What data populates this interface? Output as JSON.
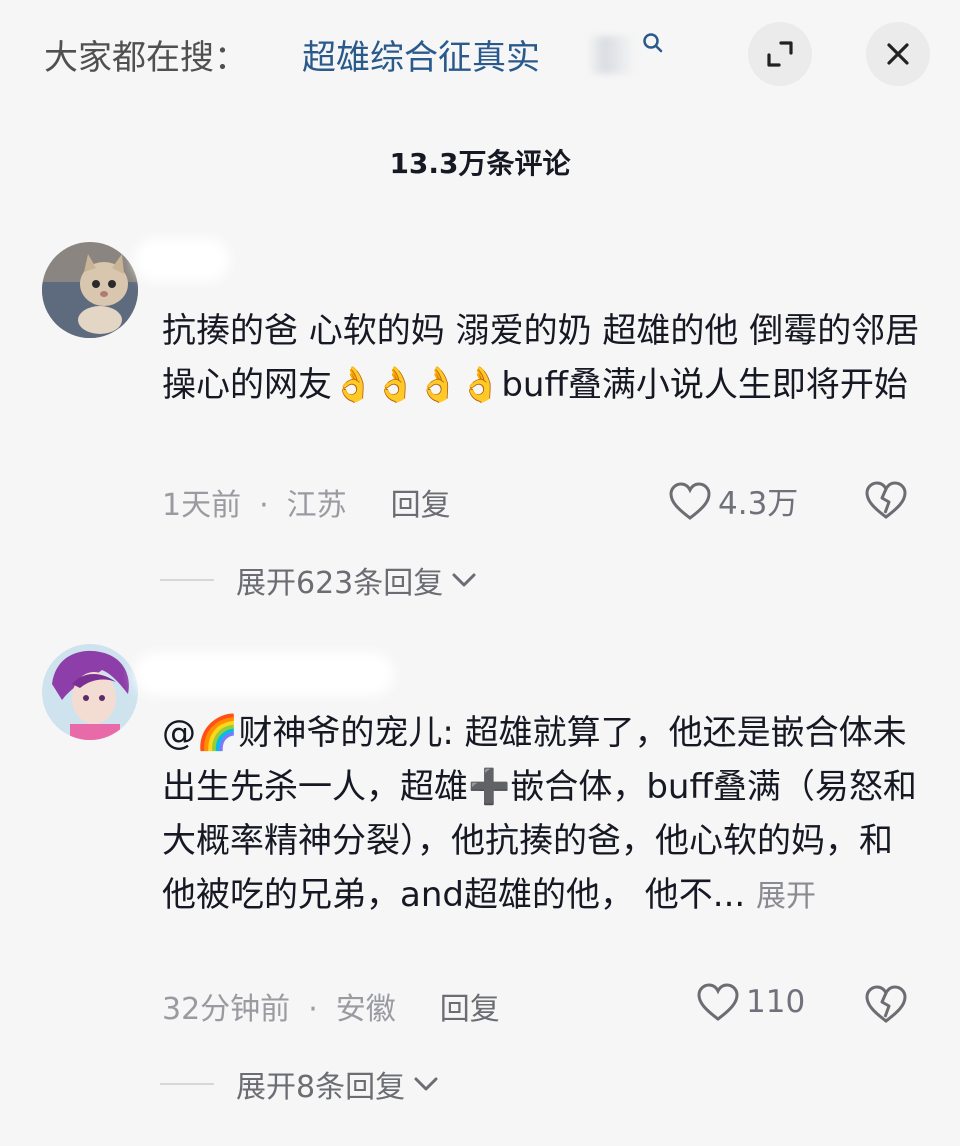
{
  "search": {
    "hint": "大家都在搜：",
    "term": "超雄综合征真实"
  },
  "header": {
    "comment_count": "13.3万条评论"
  },
  "comments": [
    {
      "text": "抗揍的爸  心软的妈  溺爱的奶  超雄的他 倒霉的邻居 操心的网友👌👌👌👌buff叠满小说人生即将开始",
      "time": "1天前",
      "location": "江苏",
      "reply_label": "回复",
      "likes": "4.3万",
      "expand_replies": "展开623条回复"
    },
    {
      "text": "@🌈财神爷的宠儿: 超雄就算了，他还是嵌合体未出生先杀一人，超雄➕嵌合体，buff叠满（易怒和大概率精神分裂），他抗揍的爸，他心软的妈，和他被吃的兄弟，and超雄的他， 他不...",
      "expand_label": "展开",
      "time": "32分钟前",
      "location": "安徽",
      "reply_label": "回复",
      "likes": "110",
      "expand_replies": "展开8条回复"
    }
  ],
  "icons": {
    "search": "search-icon",
    "expand": "expand-icon",
    "close": "close-icon",
    "like": "heart-icon",
    "dislike": "broken-heart-icon",
    "chevron": "chevron-down-icon"
  },
  "colors": {
    "background": "#f6f6f6",
    "search_term": "#2a5a8c",
    "text": "#161823",
    "meta": "#9a9ba1"
  }
}
